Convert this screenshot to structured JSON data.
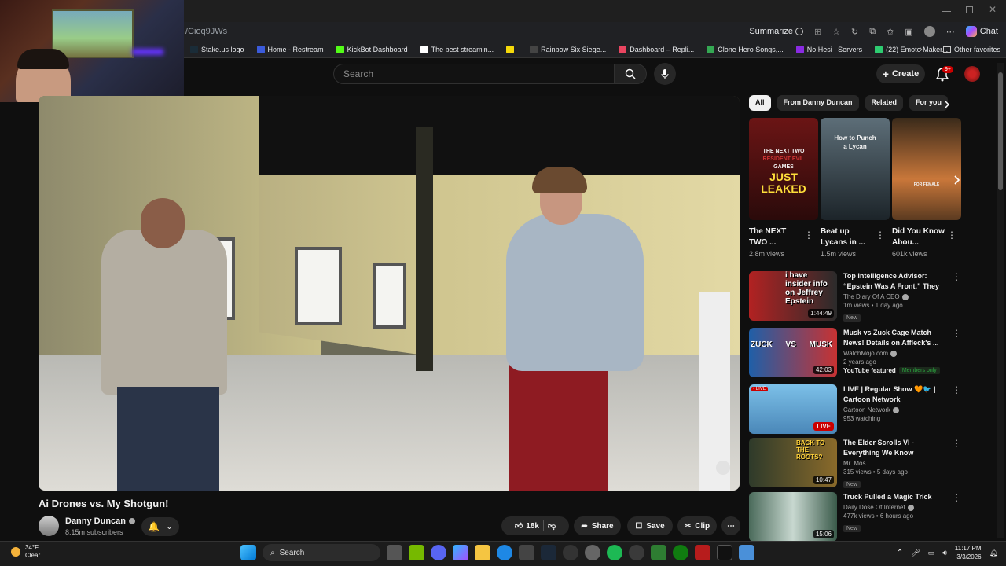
{
  "browser": {
    "url_fragment": "/Cioq9JWs",
    "summarize_label": "Summarize",
    "chat_label": "Chat",
    "bookmarks": [
      {
        "label": "Stake.us logo",
        "color": "#1a2c38"
      },
      {
        "label": "Home - Restream",
        "color": "#3b5bdb"
      },
      {
        "label": "KickBot Dashboard",
        "color": "#53fc18"
      },
      {
        "label": "The best streamin...",
        "color": "#ffffff"
      },
      {
        "label": "",
        "color": "#f5d90a"
      },
      {
        "label": "Rainbow Six Siege...",
        "color": "#444444"
      },
      {
        "label": "Dashboard – Repli...",
        "color": "#e94560"
      },
      {
        "label": "Clone Hero Songs,...",
        "color": "#34a853"
      },
      {
        "label": "No Hesi | Servers",
        "color": "#8a2be2"
      },
      {
        "label": "(22) Emote Maker...",
        "color": "#2ecc71"
      }
    ],
    "other_favorites": "Other favorites"
  },
  "youtube": {
    "search_placeholder": "Search",
    "create_label": "Create",
    "notif_count": "9+"
  },
  "video": {
    "title": "Ai Drones vs. My Shotgun!",
    "channel": "Danny Duncan",
    "subscribers": "8.15m subscribers",
    "likes": "18k",
    "share_label": "Share",
    "save_label": "Save",
    "clip_label": "Clip"
  },
  "chips": [
    "All",
    "From Danny Duncan",
    "Related",
    "For you"
  ],
  "shorts": [
    {
      "title": "The NEXT TWO ...",
      "views": "2.8m views",
      "overlay_lines": [
        "THE NEXT TWO",
        "RESIDENT EVIL",
        "GAMES",
        "JUST",
        "LEAKED"
      ],
      "color": "#8b1a1a"
    },
    {
      "title": "Beat up Lycans in ...",
      "views": "1.5m views",
      "overlay_lines": [
        "How to Punch",
        "a Lycan"
      ],
      "color": "#2f3b44"
    },
    {
      "title": "Did You Know Abou...",
      "views": "601k views",
      "overlay_lines": [
        "FOR FEMALE"
      ],
      "color": "#b8662e"
    }
  ],
  "recommendations": [
    {
      "title": "Top Intelligence Advisor: “Epstein Was A Front.” They C...",
      "channel": "The Diary Of A CEO",
      "meta": "1m views • 1 day ago",
      "badge": "New",
      "duration": "1:44:49",
      "thumb_text": "i have insider info on Jeffrey Epstein",
      "color": "#c0392b"
    },
    {
      "title": "Musk vs Zuck Cage Match News! Details on Affleck's ...",
      "channel": "WatchMojo.com",
      "meta": "2 years ago",
      "badge": "YouTube featured",
      "members": "Members only",
      "duration": "42:03",
      "thumb_text": "ZUCK VS MUSK",
      "color": "#2c6fb3"
    },
    {
      "title": "LIVE | Regular Show 🧡🐦 | Cartoon Network",
      "channel": "Cartoon Network",
      "meta": "953 watching",
      "live": "LIVE",
      "livetag": "• LIVE",
      "color": "#5fa8d3"
    },
    {
      "title": "The Elder Scrolls VI - Everything We Know",
      "channel": "Mr. Mos",
      "meta": "315 views • 5 days ago",
      "badge": "New",
      "duration": "10:47",
      "thumb_text": "BACK TO THE ROOTS?",
      "color": "#5a4a2a"
    },
    {
      "title": "Truck Pulled a Magic Trick",
      "channel": "Daily Dose Of Internet",
      "meta": "477k views • 6 hours ago",
      "badge": "New",
      "duration": "15:06",
      "color": "#3a5a4a"
    }
  ],
  "taskbar": {
    "temp": "34°F",
    "weather": "Clear",
    "search_label": "Search",
    "time": "11:17 PM",
    "date": "3/3/2026"
  }
}
